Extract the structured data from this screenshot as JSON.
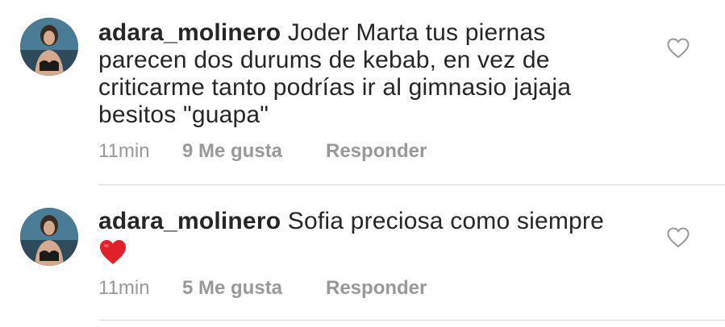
{
  "comments": [
    {
      "username": "adara_molinero",
      "text": "Joder Marta tus piernas parecen dos durums de kebab, en vez de criticarme tanto podrías ir al gimnasio jajaja besitos \"guapa\"",
      "time": "11min",
      "likes": "9 Me gusta",
      "reply": "Responder"
    },
    {
      "username": "adara_molinero",
      "text": "Sofia preciosa como siempre",
      "emoji": "heart-emoji",
      "time": "11min",
      "likes": "5 Me gusta",
      "reply": "Responder"
    }
  ],
  "colors": {
    "text": "#262626",
    "meta": "#999999",
    "divider": "#dbdbdb",
    "heart_emoji": "#e0202a"
  },
  "icons": {
    "like": "heart-outline-icon",
    "avatar": "profile-avatar"
  }
}
